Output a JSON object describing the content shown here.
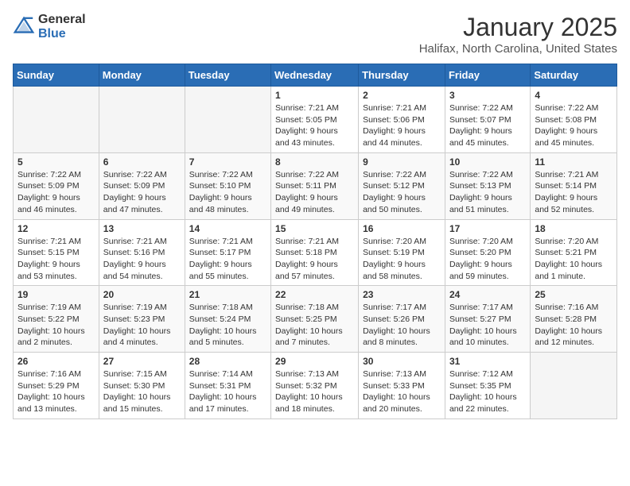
{
  "header": {
    "logo_general": "General",
    "logo_blue": "Blue",
    "title": "January 2025",
    "subtitle": "Halifax, North Carolina, United States"
  },
  "weekdays": [
    "Sunday",
    "Monday",
    "Tuesday",
    "Wednesday",
    "Thursday",
    "Friday",
    "Saturday"
  ],
  "weeks": [
    [
      {
        "day": "",
        "info": ""
      },
      {
        "day": "",
        "info": ""
      },
      {
        "day": "",
        "info": ""
      },
      {
        "day": "1",
        "info": "Sunrise: 7:21 AM\nSunset: 5:05 PM\nDaylight: 9 hours\nand 43 minutes."
      },
      {
        "day": "2",
        "info": "Sunrise: 7:21 AM\nSunset: 5:06 PM\nDaylight: 9 hours\nand 44 minutes."
      },
      {
        "day": "3",
        "info": "Sunrise: 7:22 AM\nSunset: 5:07 PM\nDaylight: 9 hours\nand 45 minutes."
      },
      {
        "day": "4",
        "info": "Sunrise: 7:22 AM\nSunset: 5:08 PM\nDaylight: 9 hours\nand 45 minutes."
      }
    ],
    [
      {
        "day": "5",
        "info": "Sunrise: 7:22 AM\nSunset: 5:09 PM\nDaylight: 9 hours\nand 46 minutes."
      },
      {
        "day": "6",
        "info": "Sunrise: 7:22 AM\nSunset: 5:09 PM\nDaylight: 9 hours\nand 47 minutes."
      },
      {
        "day": "7",
        "info": "Sunrise: 7:22 AM\nSunset: 5:10 PM\nDaylight: 9 hours\nand 48 minutes."
      },
      {
        "day": "8",
        "info": "Sunrise: 7:22 AM\nSunset: 5:11 PM\nDaylight: 9 hours\nand 49 minutes."
      },
      {
        "day": "9",
        "info": "Sunrise: 7:22 AM\nSunset: 5:12 PM\nDaylight: 9 hours\nand 50 minutes."
      },
      {
        "day": "10",
        "info": "Sunrise: 7:22 AM\nSunset: 5:13 PM\nDaylight: 9 hours\nand 51 minutes."
      },
      {
        "day": "11",
        "info": "Sunrise: 7:21 AM\nSunset: 5:14 PM\nDaylight: 9 hours\nand 52 minutes."
      }
    ],
    [
      {
        "day": "12",
        "info": "Sunrise: 7:21 AM\nSunset: 5:15 PM\nDaylight: 9 hours\nand 53 minutes."
      },
      {
        "day": "13",
        "info": "Sunrise: 7:21 AM\nSunset: 5:16 PM\nDaylight: 9 hours\nand 54 minutes."
      },
      {
        "day": "14",
        "info": "Sunrise: 7:21 AM\nSunset: 5:17 PM\nDaylight: 9 hours\nand 55 minutes."
      },
      {
        "day": "15",
        "info": "Sunrise: 7:21 AM\nSunset: 5:18 PM\nDaylight: 9 hours\nand 57 minutes."
      },
      {
        "day": "16",
        "info": "Sunrise: 7:20 AM\nSunset: 5:19 PM\nDaylight: 9 hours\nand 58 minutes."
      },
      {
        "day": "17",
        "info": "Sunrise: 7:20 AM\nSunset: 5:20 PM\nDaylight: 9 hours\nand 59 minutes."
      },
      {
        "day": "18",
        "info": "Sunrise: 7:20 AM\nSunset: 5:21 PM\nDaylight: 10 hours\nand 1 minute."
      }
    ],
    [
      {
        "day": "19",
        "info": "Sunrise: 7:19 AM\nSunset: 5:22 PM\nDaylight: 10 hours\nand 2 minutes."
      },
      {
        "day": "20",
        "info": "Sunrise: 7:19 AM\nSunset: 5:23 PM\nDaylight: 10 hours\nand 4 minutes."
      },
      {
        "day": "21",
        "info": "Sunrise: 7:18 AM\nSunset: 5:24 PM\nDaylight: 10 hours\nand 5 minutes."
      },
      {
        "day": "22",
        "info": "Sunrise: 7:18 AM\nSunset: 5:25 PM\nDaylight: 10 hours\nand 7 minutes."
      },
      {
        "day": "23",
        "info": "Sunrise: 7:17 AM\nSunset: 5:26 PM\nDaylight: 10 hours\nand 8 minutes."
      },
      {
        "day": "24",
        "info": "Sunrise: 7:17 AM\nSunset: 5:27 PM\nDaylight: 10 hours\nand 10 minutes."
      },
      {
        "day": "25",
        "info": "Sunrise: 7:16 AM\nSunset: 5:28 PM\nDaylight: 10 hours\nand 12 minutes."
      }
    ],
    [
      {
        "day": "26",
        "info": "Sunrise: 7:16 AM\nSunset: 5:29 PM\nDaylight: 10 hours\nand 13 minutes."
      },
      {
        "day": "27",
        "info": "Sunrise: 7:15 AM\nSunset: 5:30 PM\nDaylight: 10 hours\nand 15 minutes."
      },
      {
        "day": "28",
        "info": "Sunrise: 7:14 AM\nSunset: 5:31 PM\nDaylight: 10 hours\nand 17 minutes."
      },
      {
        "day": "29",
        "info": "Sunrise: 7:13 AM\nSunset: 5:32 PM\nDaylight: 10 hours\nand 18 minutes."
      },
      {
        "day": "30",
        "info": "Sunrise: 7:13 AM\nSunset: 5:33 PM\nDaylight: 10 hours\nand 20 minutes."
      },
      {
        "day": "31",
        "info": "Sunrise: 7:12 AM\nSunset: 5:35 PM\nDaylight: 10 hours\nand 22 minutes."
      },
      {
        "day": "",
        "info": ""
      }
    ]
  ]
}
